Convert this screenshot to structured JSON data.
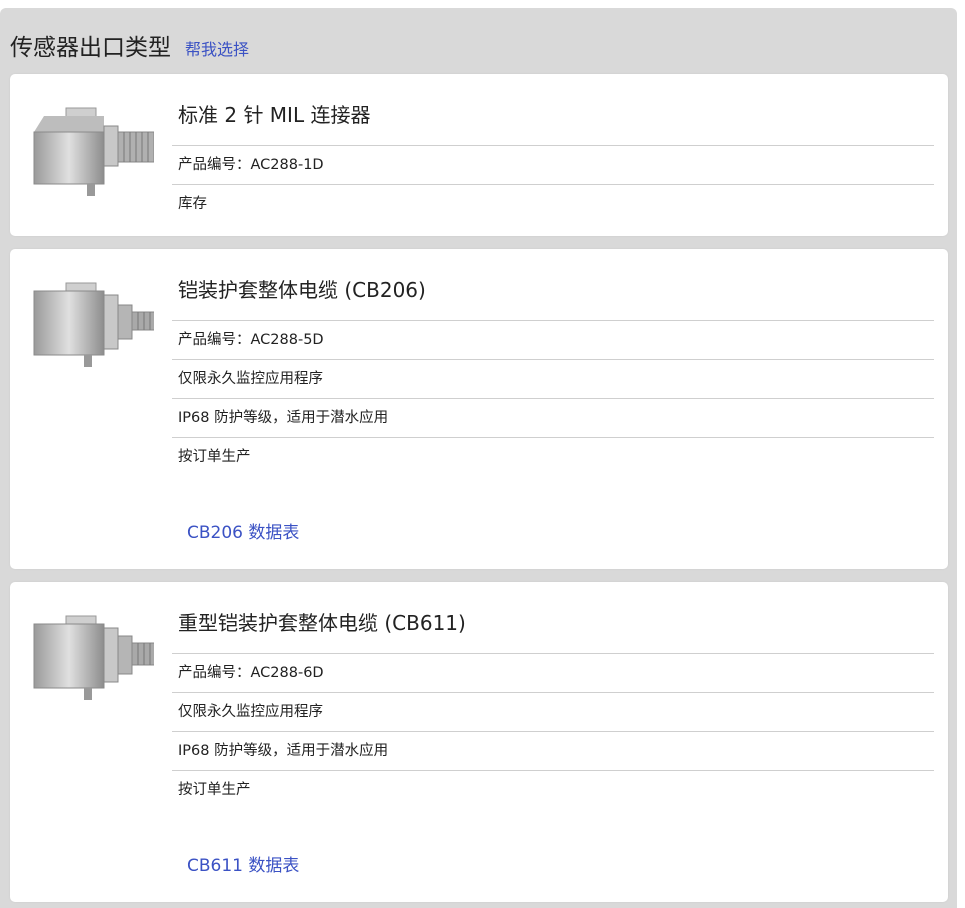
{
  "header": {
    "title": "传感器出口类型",
    "help_link": "帮我选择"
  },
  "products": [
    {
      "title": "标准 2 针 MIL 连接器",
      "image_icon": "mil-connector-sensor",
      "rows": [
        "产品编号：AC288-1D",
        "库存"
      ],
      "datasheet": ""
    },
    {
      "title": "铠装护套整体电缆 (CB206)",
      "image_icon": "armored-cable-sensor",
      "rows": [
        "产品编号：AC288-5D",
        "仅限永久监控应用程序",
        "IP68 防护等级，适用于潜水应用",
        "按订单生产"
      ],
      "datasheet": "CB206 数据表"
    },
    {
      "title": "重型铠装护套整体电缆 (CB611)",
      "image_icon": "heavy-armored-cable-sensor",
      "rows": [
        "产品编号：AC288-6D",
        "仅限永久监控应用程序",
        "IP68 防护等级，适用于潜水应用",
        "按订单生产"
      ],
      "datasheet": "CB611 数据表"
    }
  ]
}
